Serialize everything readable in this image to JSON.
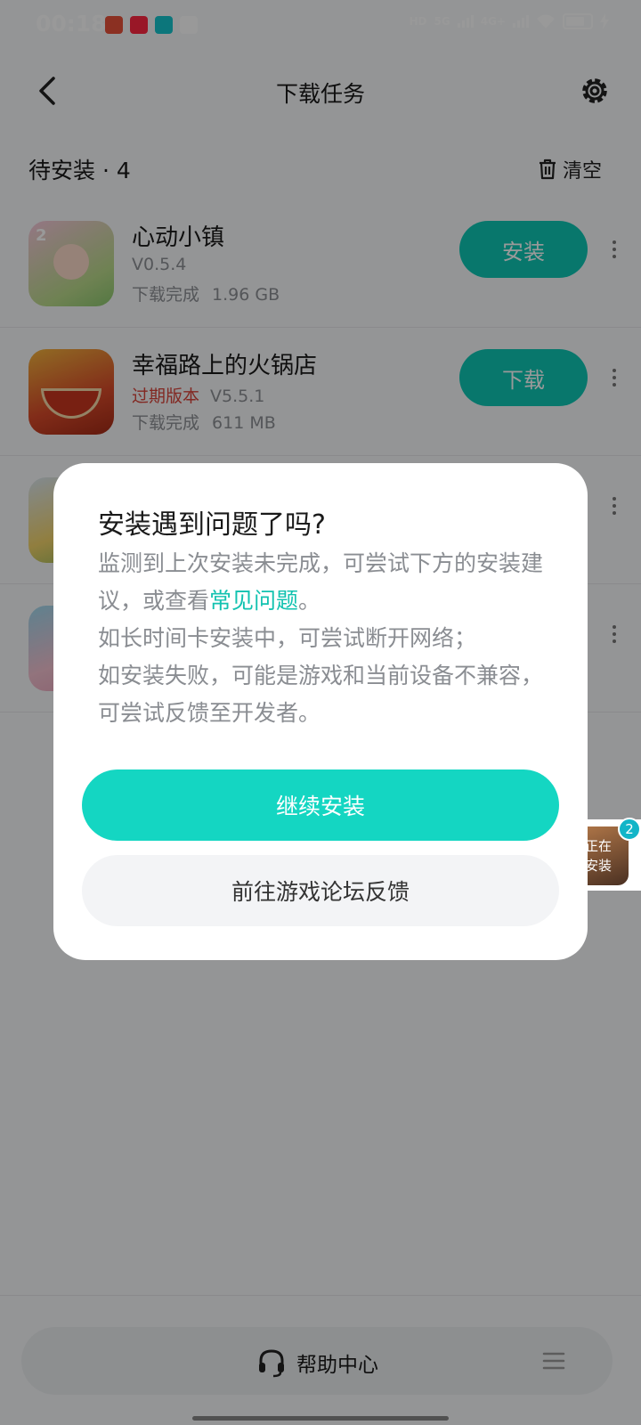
{
  "status_bar": {
    "time": "00:18",
    "net1": "HD",
    "net2": "5G",
    "net3": "4G+"
  },
  "header": {
    "title": "下载任务",
    "back_icon": "chevron-left-icon",
    "settings_icon": "gear-icon"
  },
  "section": {
    "title": "待安装 · 4",
    "clear_label": "清空"
  },
  "apps": [
    {
      "name": "心动小镇",
      "expired_label": "",
      "version": "V0.5.4",
      "status": "下载完成",
      "size": "1.96 GB",
      "action": "安装",
      "icon_color": "#e9a9c8"
    },
    {
      "name": "幸福路上的火锅店",
      "expired_label": "过期版本",
      "version": "V5.5.1",
      "status": "下载完成",
      "size": "611 MB",
      "action": "下载",
      "icon_color": "#d84a2a"
    }
  ],
  "dialog": {
    "title": "安装遇到问题了吗?",
    "line1": "监测到上次安装未完成，可尝试下方的安装建议，或查看",
    "link": "常见问题",
    "line1_end": "。",
    "line2": "如长时间卡安装中，可尝试断开网络；",
    "line3": "如安装失败，可能是游戏和当前设备不兼容，可尝试反馈至开发者。",
    "primary": "继续安装",
    "secondary": "前往游戏论坛反馈"
  },
  "floating": {
    "text_line1": "正在",
    "text_line2": "安装",
    "badge": "2"
  },
  "bottom": {
    "help_label": "帮助中心",
    "help_icon": "headset-icon",
    "menu_icon": "menu-icon"
  },
  "colors": {
    "accent": "#14d6c2",
    "expired": "#d9443a"
  }
}
